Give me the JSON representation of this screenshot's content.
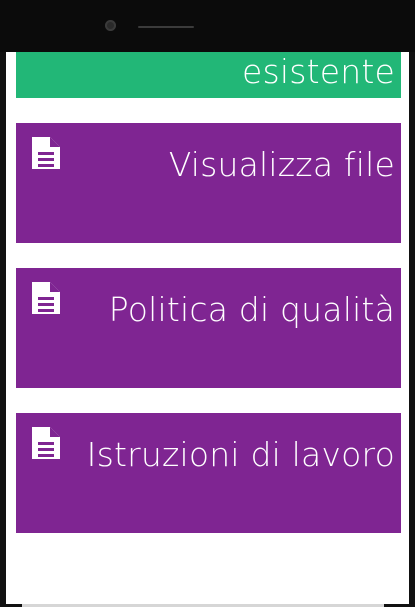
{
  "screen": {
    "tiles": [
      {
        "label": "esistente",
        "color": "#22b777",
        "icon": ""
      },
      {
        "label": "Visualizza file",
        "color": "#7f2592",
        "icon": "document-icon"
      },
      {
        "label": "Politica di qualità",
        "color": "#7f2592",
        "icon": "document-icon"
      },
      {
        "label": "Istruzioni di lavoro",
        "color": "#7f2592",
        "icon": "document-icon"
      }
    ]
  }
}
